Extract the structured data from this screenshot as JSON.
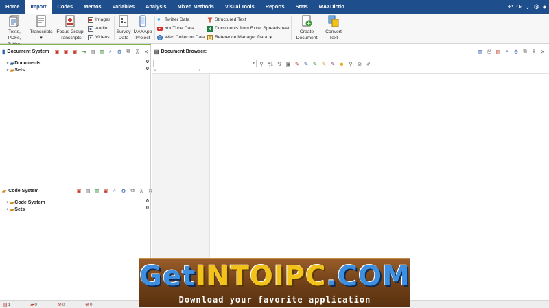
{
  "menu": {
    "tabs": [
      "Home",
      "Import",
      "Codes",
      "Memos",
      "Variables",
      "Analysis",
      "Mixed Methods",
      "Visual Tools",
      "Reports",
      "Stats",
      "MAXDictio"
    ],
    "active_tab": "Import"
  },
  "ribbon": {
    "texts_label_1": "Texts, PDFs,",
    "texts_label_2": "Tables",
    "transcripts_label": "Transcripts",
    "focus_label_1": "Focus Group",
    "focus_label_2": "Transcripts",
    "images_label": "Images",
    "audio_label": "Audio",
    "videos_label": "Videos",
    "survey_label_1": "Survey",
    "survey_label_2": "Data",
    "maxapp_label_1": "MAXApp",
    "maxapp_label_2": "Project",
    "twitter_label": "Twitter Data",
    "youtube_label": "YouTube Data",
    "webcollector_label": "Web Collector Data",
    "structured_label": "Structured Text",
    "excel_label": "Documents from Excel Spreadsheet",
    "reference_label": "Reference Manager Data",
    "create_label_1": "Create",
    "create_label_2": "Document",
    "convert_label_1": "Convert",
    "convert_label_2": "Text"
  },
  "document_system": {
    "title": "Document System",
    "items": [
      {
        "label": "Documents",
        "count": "0"
      },
      {
        "label": "Sets",
        "count": "0"
      }
    ]
  },
  "code_system": {
    "title": "Code System",
    "items": [
      {
        "label": "Code System",
        "count": "0"
      },
      {
        "label": "Sets",
        "count": "0"
      }
    ]
  },
  "document_browser": {
    "title": "Document Browser:",
    "ruler_marks": [
      "4",
      "0"
    ]
  },
  "statusbar": {
    "items": [
      {
        "icon": "document-icon",
        "value": "1"
      },
      {
        "icon": "code-icon",
        "value": "0"
      },
      {
        "icon": "coded-segment-icon",
        "value": "0"
      },
      {
        "icon": "memo-icon",
        "value": "0"
      }
    ]
  },
  "watermark": {
    "title_a": "Get",
    "title_b": "INTO",
    "title_c": "IPC",
    "title_d": ".COM",
    "subtitle": "Download your favorite application"
  },
  "colors": {
    "menubar": "#1f4e8c",
    "accent_green": "#7fb447",
    "watermark_blue": "#3f8fe0",
    "watermark_yellow": "#f2c21b"
  }
}
